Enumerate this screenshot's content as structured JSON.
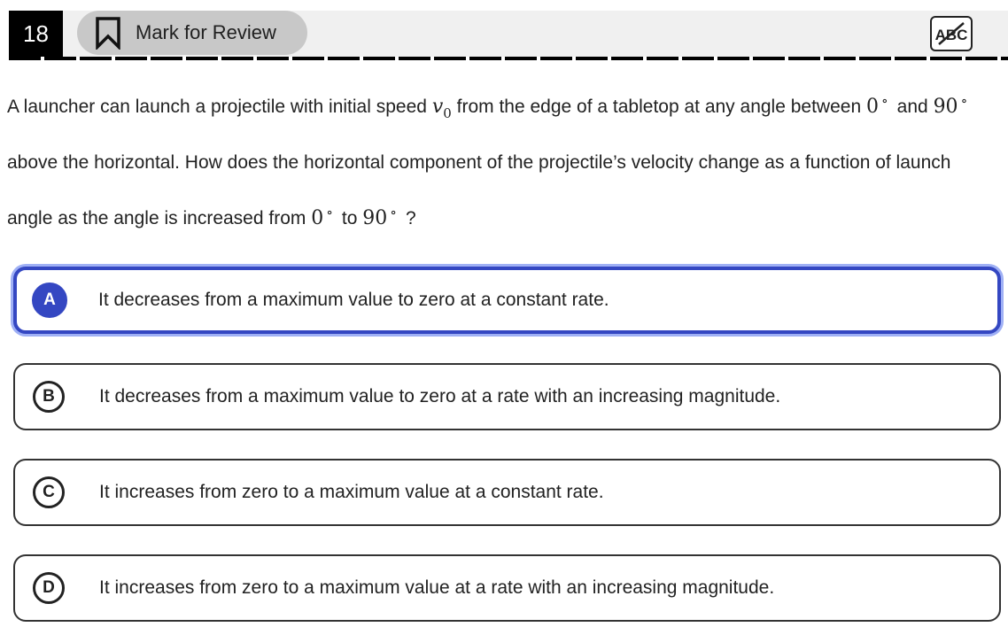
{
  "header": {
    "question_number": "18",
    "mark_for_review_label": "Mark for Review",
    "abc_label": "ABC"
  },
  "question": {
    "part1": "A launcher can launch a projectile with initial speed",
    "var_v": "v",
    "var_sub": "0",
    "part2": "from the edge of a tabletop at any angle between",
    "angle_0": "0",
    "part3": "and",
    "angle_90": "90",
    "part4": "above the horizontal. How does the horizontal component of the projectile’s velocity change as a function of launch angle as the angle is increased from",
    "angle_from": "0",
    "part5": "to",
    "angle_to": "90",
    "part6": "?",
    "degree": "∘"
  },
  "options": [
    {
      "letter": "A",
      "text": "It decreases from a maximum value to zero at a constant rate.",
      "selected": true
    },
    {
      "letter": "B",
      "text": "It decreases from a maximum value to zero at a rate with an increasing magnitude.",
      "selected": false
    },
    {
      "letter": "C",
      "text": "It increases from zero to a maximum value at a constant rate.",
      "selected": false
    },
    {
      "letter": "D",
      "text": "It increases from zero to a maximum value at a rate with an increasing magnitude.",
      "selected": false
    }
  ],
  "colors": {
    "accent": "#3447c2",
    "header_bg": "#f0f0f0",
    "mark_button_bg": "#c8c8c8"
  }
}
